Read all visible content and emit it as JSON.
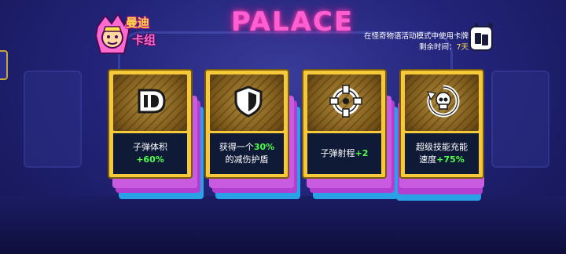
{
  "header": {
    "logo_title": "曼迪",
    "logo_subtitle": "卡组",
    "sign_text": "PALACE",
    "info_line1": "在怪奇物语活动模式中使用卡牌",
    "info_line2_label": "剩余时间：",
    "info_line2_value": "7天"
  },
  "cards": [
    {
      "icon": "bullet-size-icon",
      "line1": "子弹体积",
      "line1_value": "",
      "line2": "",
      "line2_value": "+60%"
    },
    {
      "icon": "shield-icon",
      "line1": "获得一个",
      "line1_value": "30%",
      "line2": "的减伤护盾",
      "line2_value": ""
    },
    {
      "icon": "crosshair-icon",
      "line1": "子弹射程",
      "line1_value": "+2",
      "line2": "",
      "line2_value": ""
    },
    {
      "icon": "skull-charge-icon",
      "line1": "超级技能充能",
      "line1_value": "",
      "line2": "速度",
      "line2_value": "+75%"
    }
  ],
  "colors": {
    "card_gold": "#f6c93a",
    "stack_purple": "#b23fd0",
    "stack_blue": "#2aa0e6",
    "value_green": "#4dff4a",
    "sign_pink": "#ff5fd0"
  }
}
